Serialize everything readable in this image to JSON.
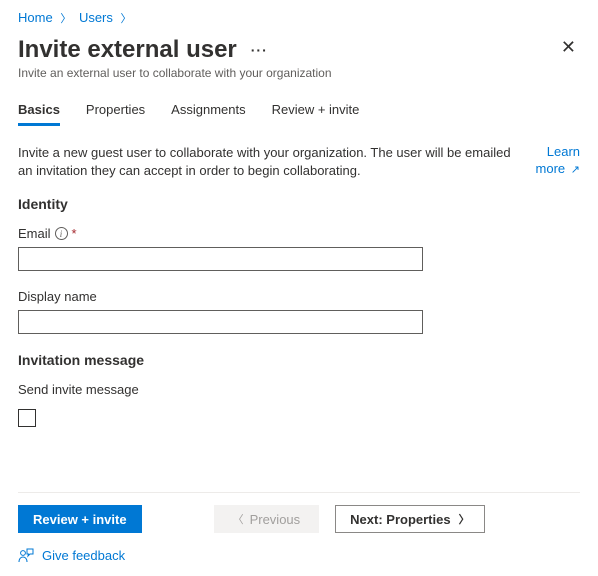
{
  "breadcrumb": {
    "items": [
      "Home",
      "Users"
    ]
  },
  "header": {
    "title": "Invite external user",
    "subtitle": "Invite an external user to collaborate with your organization"
  },
  "tabs": {
    "items": [
      {
        "label": "Basics",
        "active": true
      },
      {
        "label": "Properties",
        "active": false
      },
      {
        "label": "Assignments",
        "active": false
      },
      {
        "label": "Review + invite",
        "active": false
      }
    ]
  },
  "intro": {
    "text": "Invite a new guest user to collaborate with your organization. The user will be emailed an invitation they can accept in order to begin collaborating.",
    "learn_more_line1": "Learn",
    "learn_more_line2": "more"
  },
  "sections": {
    "identity": "Identity",
    "invitation": "Invitation message"
  },
  "fields": {
    "email_label": "Email",
    "display_name_label": "Display name",
    "send_invite_label": "Send invite message",
    "email_value": "",
    "display_name_value": "",
    "send_invite_checked": false
  },
  "footer": {
    "primary": "Review + invite",
    "previous": "Previous",
    "next": "Next: Properties",
    "feedback": "Give feedback"
  }
}
